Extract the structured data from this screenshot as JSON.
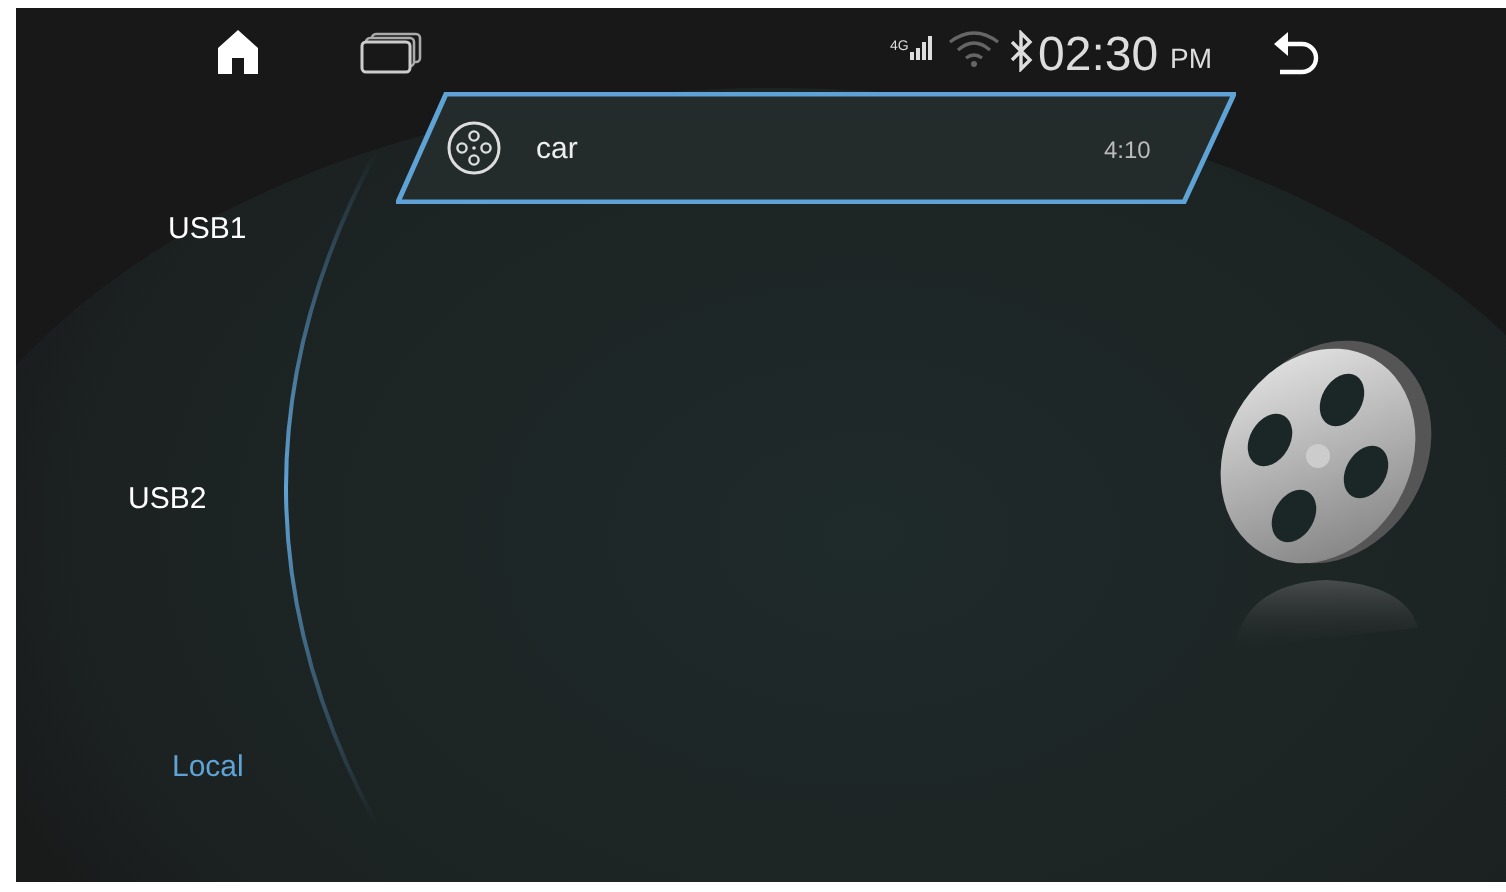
{
  "status_bar": {
    "network": "4G",
    "time": "02:30",
    "meridiem": "PM"
  },
  "sources": [
    {
      "label": "USB1",
      "selected": false
    },
    {
      "label": "USB2",
      "selected": false
    },
    {
      "label": "Local",
      "selected": true
    }
  ],
  "files": [
    {
      "title": "car",
      "duration": "4:10",
      "selected": true
    }
  ]
}
